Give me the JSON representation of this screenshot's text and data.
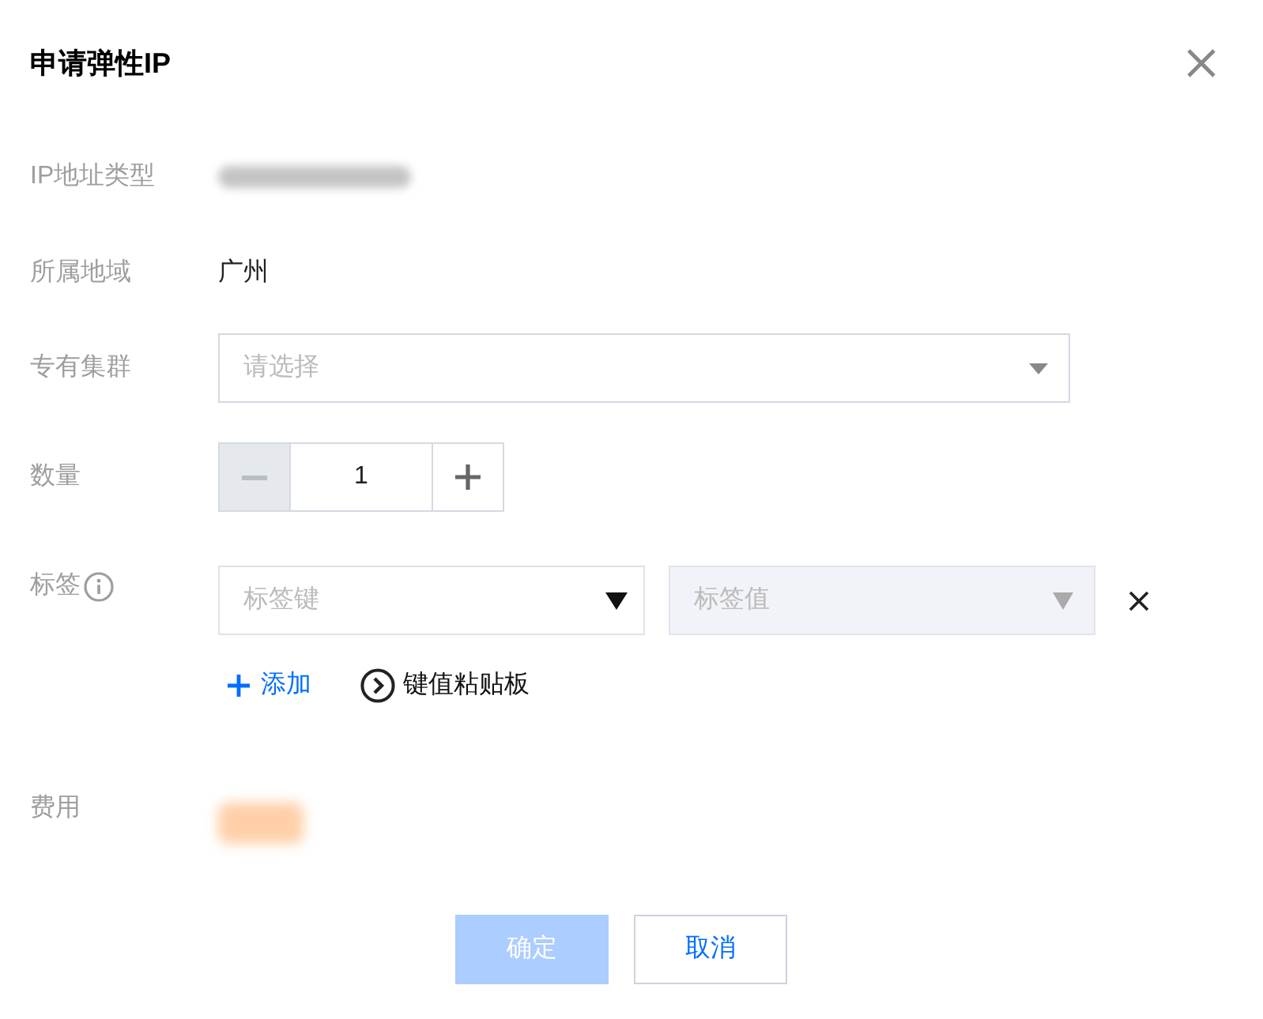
{
  "dialog": {
    "title": "申请弹性IP"
  },
  "fields": [
    {
      "kind": "blurred",
      "label": "IP地址类型",
      "color": "#c4c4c4"
    },
    {
      "kind": "text",
      "label": "所属地域",
      "value": "广州"
    },
    {
      "kind": "select",
      "label": "专有集群",
      "placeholder": "请选择"
    },
    {
      "kind": "stepper",
      "label": "数量",
      "value": "1",
      "decrement_disabled": true,
      "increment_disabled": false
    },
    {
      "kind": "tags",
      "label": "标签",
      "rows": [
        {
          "key_placeholder": "标签键",
          "value_placeholder": "标签值",
          "value_disabled": true
        }
      ],
      "add_label": "添加",
      "paste_label": "键值粘贴板"
    },
    {
      "kind": "price",
      "label": "费用",
      "color": "#ffcfa8"
    }
  ],
  "buttons": [
    {
      "label": "确定",
      "kind": "primary",
      "disabled": true
    },
    {
      "label": "取消",
      "kind": "secondary",
      "disabled": false
    }
  ]
}
